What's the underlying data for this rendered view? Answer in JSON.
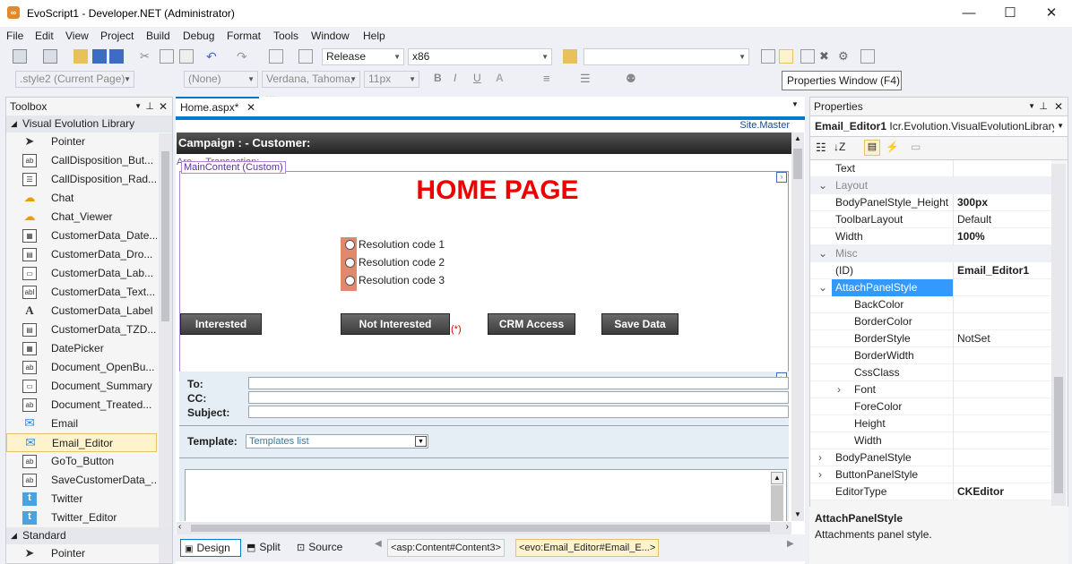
{
  "window": {
    "title": "EvoScript1 - Developer.NET (Administrator)",
    "min": "—",
    "max": "☐",
    "close": "✕"
  },
  "menu": [
    "File",
    "Edit",
    "View",
    "Project",
    "Build",
    "Debug",
    "Format",
    "Tools",
    "Window",
    "Help"
  ],
  "toolbar1": {
    "config": "Release",
    "platform": "x86",
    "search": ""
  },
  "toolbar2": {
    "style": ".style2 (Current Page)",
    "block": "(None)",
    "font": "Verdana, Tahoma, ...",
    "size": "11px",
    "bold": "B",
    "italic": "I",
    "underline": "U"
  },
  "tooltip": "Properties Window (F4)",
  "toolbox": {
    "title": "Toolbox",
    "sections": [
      {
        "label": "Visual Evolution Library"
      },
      {
        "label": "Standard"
      }
    ],
    "items": [
      {
        "label": "Pointer",
        "icon": "pointer-icon"
      },
      {
        "label": "CallDisposition_But...",
        "icon": "ab-icon"
      },
      {
        "label": "CallDisposition_Rad...",
        "icon": "radio-list-icon"
      },
      {
        "label": "Chat",
        "icon": "chat-icon"
      },
      {
        "label": "Chat_Viewer",
        "icon": "chat-icon"
      },
      {
        "label": "CustomerData_Date...",
        "icon": "calendar-icon"
      },
      {
        "label": "CustomerData_Dro...",
        "icon": "dropdown-icon"
      },
      {
        "label": "CustomerData_Lab...",
        "icon": "label-icon"
      },
      {
        "label": "CustomerData_Text...",
        "icon": "textbox-icon"
      },
      {
        "label": "CustomerData_Label",
        "icon": "a-icon"
      },
      {
        "label": "CustomerData_TZD...",
        "icon": "dropdown-icon"
      },
      {
        "label": "DatePicker",
        "icon": "calendar-icon"
      },
      {
        "label": "Document_OpenBu...",
        "icon": "ab-icon"
      },
      {
        "label": "Document_Summary",
        "icon": "label-icon"
      },
      {
        "label": "Document_Treated...",
        "icon": "ab-icon"
      },
      {
        "label": "Email",
        "icon": "mail-icon"
      },
      {
        "label": "Email_Editor",
        "icon": "mail-icon"
      },
      {
        "label": "GoTo_Button",
        "icon": "ab-icon"
      },
      {
        "label": "SaveCustomerData_...",
        "icon": "ab-icon"
      },
      {
        "label": "Twitter",
        "icon": "twitter-icon"
      },
      {
        "label": "Twitter_Editor",
        "icon": "twitter-icon"
      }
    ],
    "standard_items": [
      {
        "label": "Pointer",
        "icon": "pointer-icon"
      }
    ]
  },
  "doc": {
    "tab": "Home.aspx*",
    "master": "Site.Master",
    "campaign": "Campaign : - Customer:",
    "hidden_label": "Are ...  Transaction:",
    "mc_label": "MainContent (Custom)",
    "home": "HOME PAGE",
    "radios": [
      "Resolution code 1",
      "Resolution code 2",
      "Resolution code 3"
    ],
    "buttons": [
      "Interested",
      "Not Interested",
      "CRM Access",
      "Save Data"
    ],
    "required": "(*)",
    "email": {
      "to": "To:",
      "cc": "CC:",
      "subject": "Subject:",
      "template_label": "Template:",
      "template_value": "Templates list"
    },
    "views": {
      "design": "Design",
      "split": "Split",
      "source": "Source"
    },
    "crumbs": [
      "<asp:Content#Content3>",
      "<evo:Email_Editor#Email_E...>"
    ]
  },
  "props": {
    "title": "Properties",
    "object": "Email_Editor1",
    "type": "Icr.Evolution.VisualEvolutionLibrary",
    "rows": [
      {
        "name": "Text",
        "value": "",
        "kind": "prop"
      },
      {
        "name": "Layout",
        "value": "",
        "kind": "cat"
      },
      {
        "name": "BodyPanelStyle_Height",
        "value": "300px",
        "kind": "bold"
      },
      {
        "name": "ToolbarLayout",
        "value": "Default",
        "kind": "prop"
      },
      {
        "name": "Width",
        "value": "100%",
        "kind": "bold"
      },
      {
        "name": "Misc",
        "value": "",
        "kind": "cat"
      },
      {
        "name": "(ID)",
        "value": "Email_Editor1",
        "kind": "bold"
      },
      {
        "name": "AttachPanelStyle",
        "value": "",
        "kind": "sel"
      },
      {
        "name": "BackColor",
        "value": "",
        "kind": "sub"
      },
      {
        "name": "BorderColor",
        "value": "",
        "kind": "sub"
      },
      {
        "name": "BorderStyle",
        "value": "NotSet",
        "kind": "sub"
      },
      {
        "name": "BorderWidth",
        "value": "",
        "kind": "sub"
      },
      {
        "name": "CssClass",
        "value": "",
        "kind": "sub"
      },
      {
        "name": "Font",
        "value": "",
        "kind": "subexp"
      },
      {
        "name": "ForeColor",
        "value": "",
        "kind": "sub"
      },
      {
        "name": "Height",
        "value": "",
        "kind": "sub"
      },
      {
        "name": "Width",
        "value": "",
        "kind": "sub"
      },
      {
        "name": "BodyPanelStyle",
        "value": "",
        "kind": "exp"
      },
      {
        "name": "ButtonPanelStyle",
        "value": "",
        "kind": "exp"
      },
      {
        "name": "EditorType",
        "value": "CKEditor",
        "kind": "bold"
      }
    ],
    "desc_title": "AttachPanelStyle",
    "desc": "Attachments panel style."
  },
  "colors": {
    "accent": "#007acc",
    "selection": "#3399ff",
    "home": "#ee0000"
  }
}
